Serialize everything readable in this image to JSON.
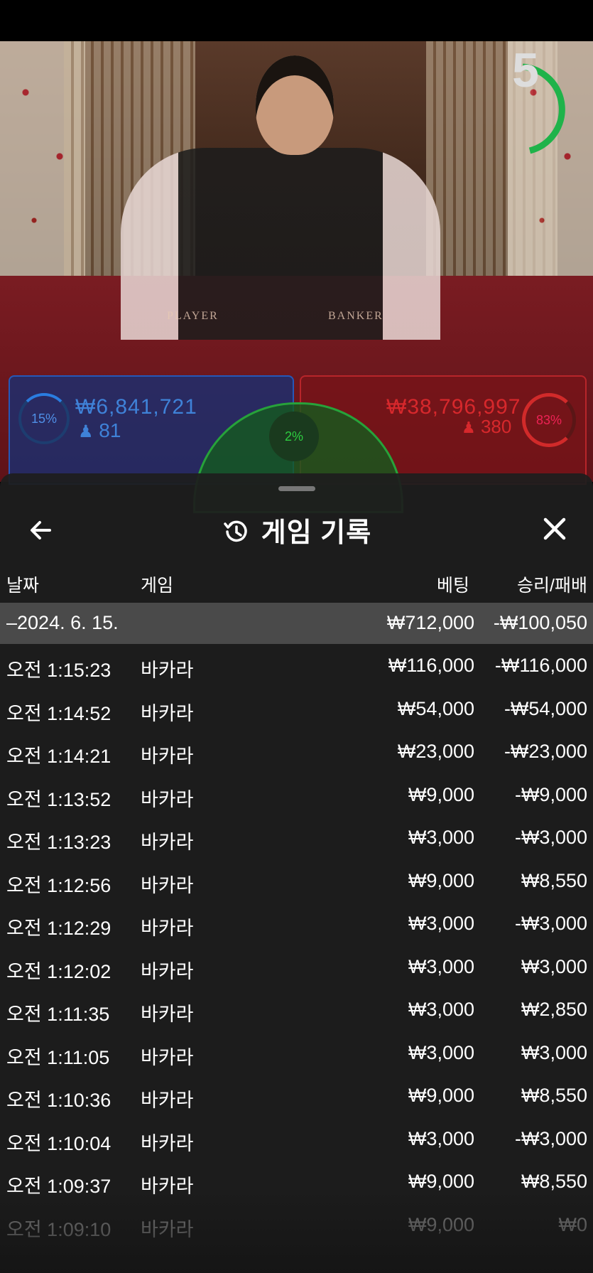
{
  "video": {
    "countdown": "5",
    "felt_player_label": "PLAYER",
    "felt_banker_label": "BANKER"
  },
  "bets": {
    "player": {
      "percent": "15%",
      "amount": "₩6,841,721",
      "players": "81"
    },
    "tie": {
      "percent": "2%"
    },
    "banker": {
      "percent": "83%",
      "amount": "₩38,796,997",
      "players": "380"
    }
  },
  "history": {
    "title": "게임 기록",
    "columns": {
      "date": "날짜",
      "game": "게임",
      "bet": "베팅",
      "win_loss": "승리/패배"
    },
    "date_group": {
      "date": "–2024. 6. 15.",
      "total_bet": "₩712,000",
      "total_wl": "-₩100,050"
    },
    "rows": [
      {
        "time": "오전 1:15:23",
        "game": "바카라",
        "bet": "₩116,000",
        "wl": "-₩116,000"
      },
      {
        "time": "오전 1:14:52",
        "game": "바카라",
        "bet": "₩54,000",
        "wl": "-₩54,000"
      },
      {
        "time": "오전 1:14:21",
        "game": "바카라",
        "bet": "₩23,000",
        "wl": "-₩23,000"
      },
      {
        "time": "오전 1:13:52",
        "game": "바카라",
        "bet": "₩9,000",
        "wl": "-₩9,000"
      },
      {
        "time": "오전 1:13:23",
        "game": "바카라",
        "bet": "₩3,000",
        "wl": "-₩3,000"
      },
      {
        "time": "오전 1:12:56",
        "game": "바카라",
        "bet": "₩9,000",
        "wl": "₩8,550"
      },
      {
        "time": "오전 1:12:29",
        "game": "바카라",
        "bet": "₩3,000",
        "wl": "-₩3,000"
      },
      {
        "time": "오전 1:12:02",
        "game": "바카라",
        "bet": "₩3,000",
        "wl": "₩3,000"
      },
      {
        "time": "오전 1:11:35",
        "game": "바카라",
        "bet": "₩3,000",
        "wl": "₩2,850"
      },
      {
        "time": "오전 1:11:05",
        "game": "바카라",
        "bet": "₩3,000",
        "wl": "₩3,000"
      },
      {
        "time": "오전 1:10:36",
        "game": "바카라",
        "bet": "₩9,000",
        "wl": "₩8,550"
      },
      {
        "time": "오전 1:10:04",
        "game": "바카라",
        "bet": "₩3,000",
        "wl": "-₩3,000"
      },
      {
        "time": "오전 1:09:37",
        "game": "바카라",
        "bet": "₩9,000",
        "wl": "₩8,550"
      },
      {
        "time": "오전 1:09:10",
        "game": "바카라",
        "bet": "₩9,000",
        "wl": "₩0"
      }
    ]
  },
  "icons": {
    "back": "arrow-left-icon",
    "history": "history-clock-icon",
    "close": "close-icon",
    "user": "user-icon"
  },
  "colors": {
    "player": "#3f82d8",
    "banker": "#d7282c",
    "tie": "#2ecc40",
    "timer": "#1fb34a"
  }
}
